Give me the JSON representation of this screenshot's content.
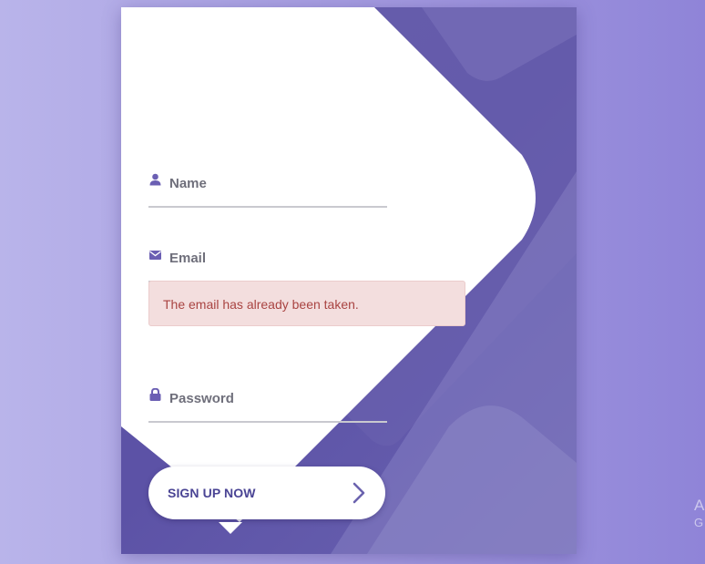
{
  "form": {
    "name_label": "Name",
    "email_label": "Email",
    "password_label": "Password",
    "error_message": "The email has already been taken.",
    "submit_label": "SIGN UP NOW"
  },
  "icons": {
    "name": "user-icon",
    "email": "envelope-icon",
    "password": "lock-icon",
    "submit": "chevron-right-icon"
  },
  "colors": {
    "accent": "#4a4494",
    "card_purple": "#5f56a8",
    "error_bg": "#f3dede",
    "error_text": "#a94442"
  },
  "watermark": {
    "line1": "A",
    "line2": "G"
  }
}
